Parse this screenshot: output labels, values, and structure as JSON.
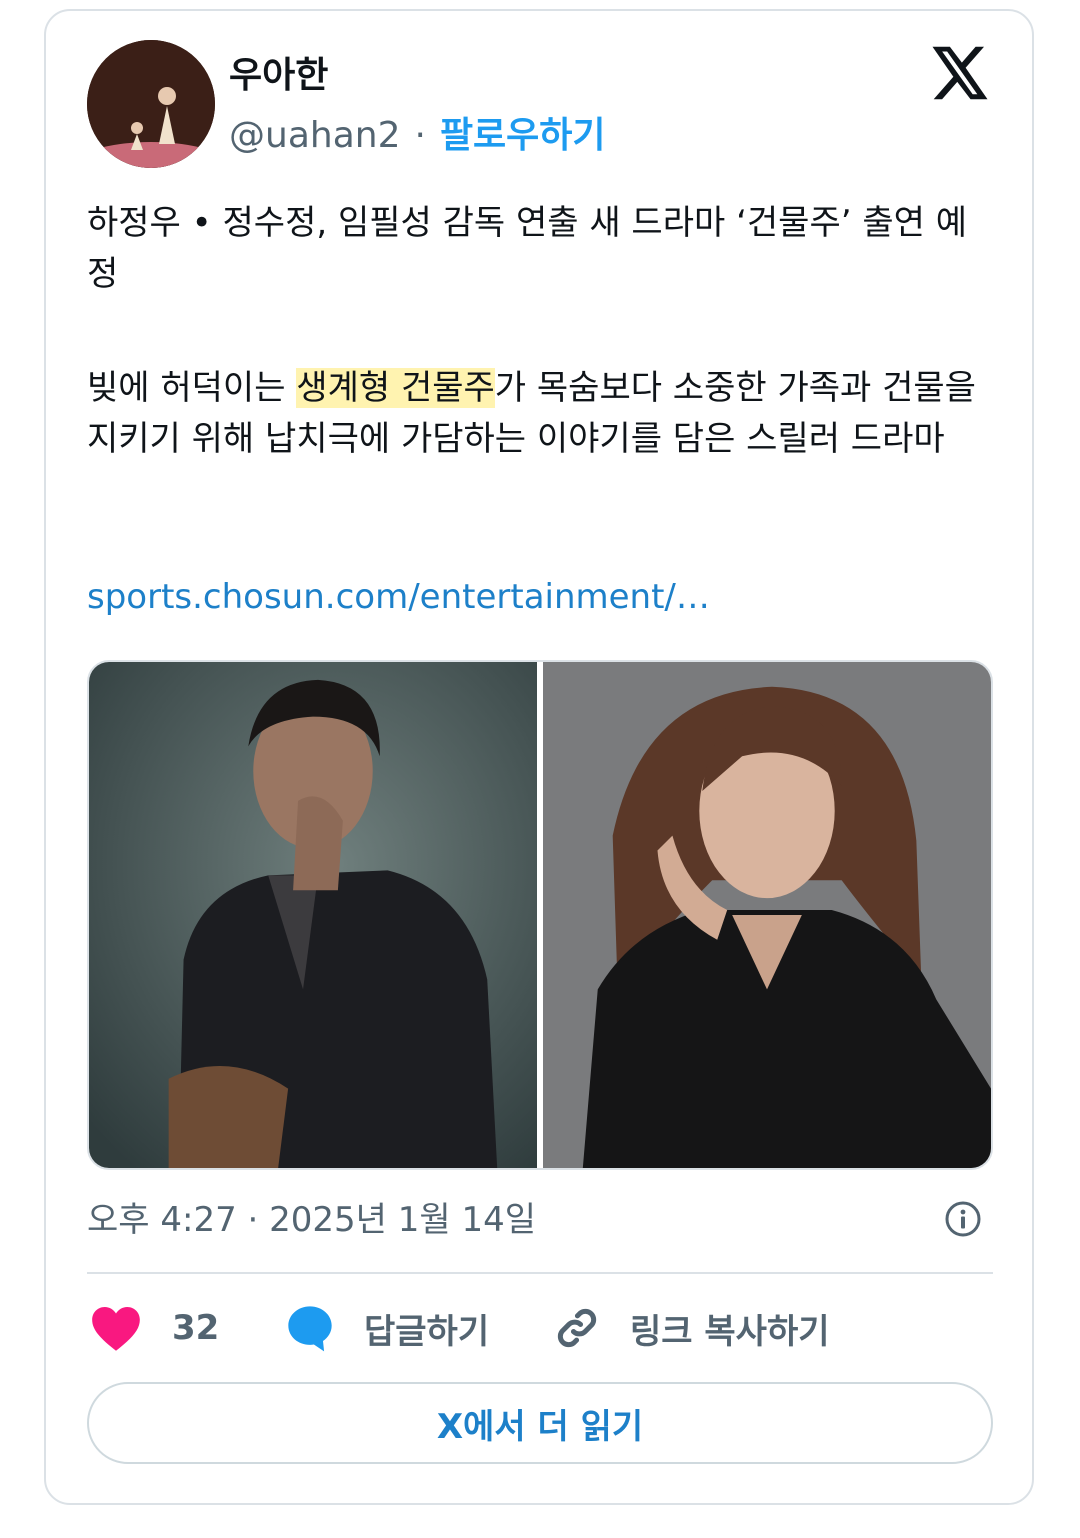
{
  "author": {
    "display_name": "우아한",
    "handle": "@uahan2",
    "separator": "·",
    "follow_label": "팔로우하기"
  },
  "tweet": {
    "line1": "하정우 • 정수정, 임필성 감독 연출 새 드라마 ‘건물주’ 출연 예정",
    "para2_before": "빚에 허덕이는 ",
    "para2_highlight": "생계형 건물주",
    "para2_after": "가 목숨보다 소중한 가족과 건물을 지키기 위해 납치극에 가담하는 이야기를 담은 스릴러 드라마",
    "link_text": "sports.chosun.com/entertainment/…"
  },
  "media": {
    "photo_count": 2
  },
  "meta": {
    "timestamp": "오후 4:27 · 2025년 1월 14일"
  },
  "actions": {
    "like_count": "32",
    "reply_label": "답글하기",
    "copy_link_label": "링크 복사하기",
    "read_more_label": "X에서 더 읽기"
  },
  "colors": {
    "like": "#f91880",
    "reply": "#1d9bf0",
    "link": "#1d80c9",
    "highlight": "#fff3b0",
    "muted": "#536471"
  }
}
